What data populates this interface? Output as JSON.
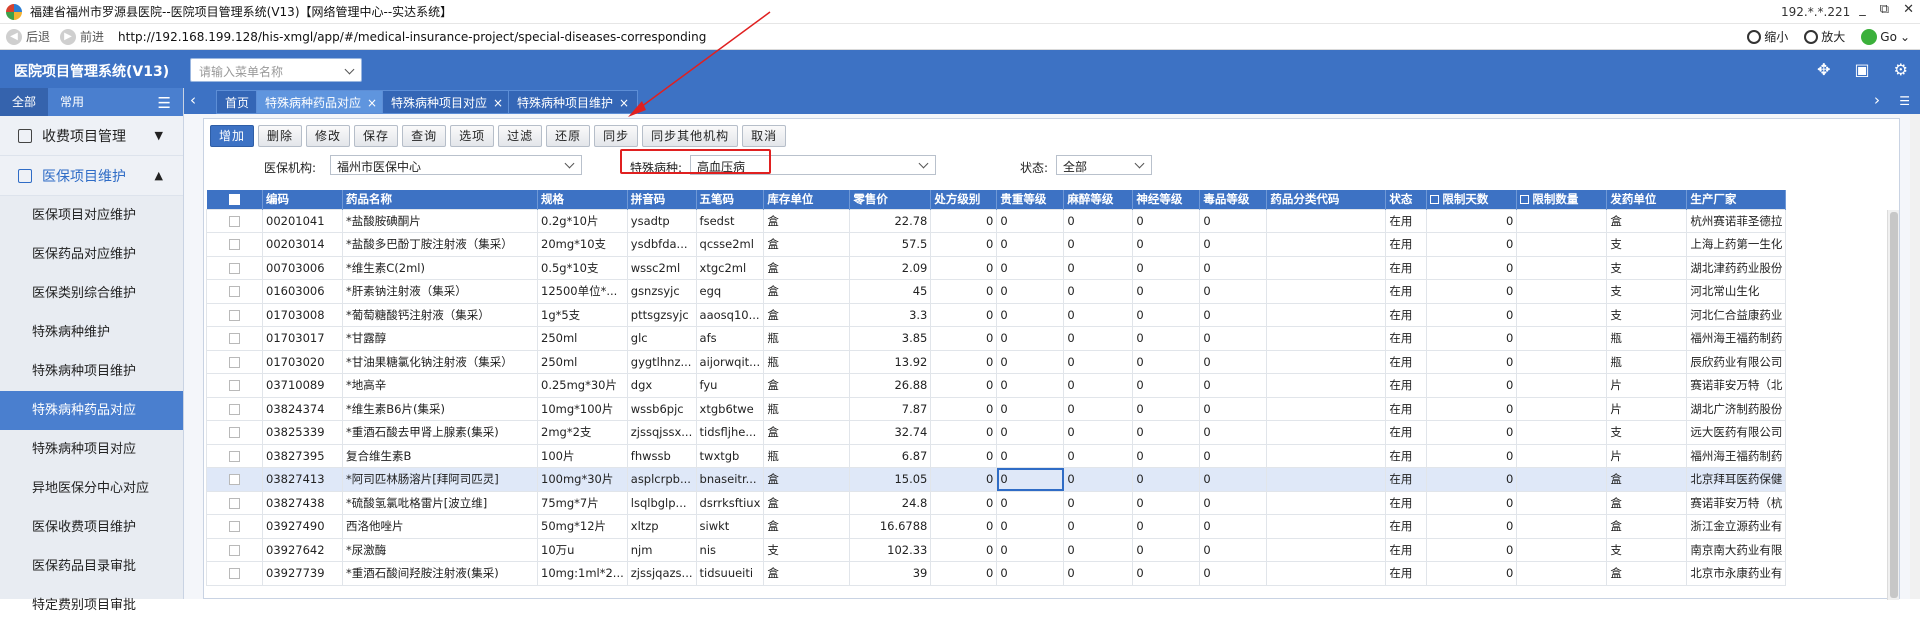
{
  "window": {
    "title": "福建省福州市罗源县医院--医院项目管理系统(V13)【网络管理中心--实达系统】",
    "ip": "192.*.*.221",
    "controls": [
      "_",
      "⧉",
      "✕"
    ]
  },
  "address": {
    "back": "后退",
    "forward": "前进",
    "url": "http://192.168.199.128/his-xmgl/app/#/medical-insurance-project/special-diseases-corresponding",
    "zoom_out": "缩小",
    "zoom_in": "放大",
    "go": "Go"
  },
  "app": {
    "brand": "医院项目管理系统(V13)",
    "menu_search_placeholder": "请输入菜单名称"
  },
  "sidebar": {
    "tabs": [
      "全部",
      "常用"
    ],
    "groups": [
      {
        "label": "收费项目管理",
        "icon": "menu-box-icon",
        "caret": "⌄"
      },
      {
        "label": "医保项目维护",
        "icon": "menu-box-icon",
        "caret": "⌃"
      }
    ],
    "items": [
      "医保项目对应维护",
      "医保药品对应维护",
      "医保类别综合维护",
      "特殊病种维护",
      "特殊病种项目维护",
      "特殊病种药品对应",
      "特殊病种项目对应",
      "异地医保分中心对应",
      "医保收费项目维护",
      "医保药品目录审批",
      "特定费别项目审批"
    ]
  },
  "page_tabs": [
    {
      "label": "首页"
    },
    {
      "label": "特殊病种药品对应",
      "close": "×"
    },
    {
      "label": "特殊病种项目对应",
      "close": "×"
    },
    {
      "label": "特殊病种项目维护",
      "close": "×"
    }
  ],
  "toolbar": [
    "增加",
    "删除",
    "修改",
    "保存",
    "查询",
    "选项",
    "过滤",
    "还原",
    "同步",
    "同步其他机构",
    "取消"
  ],
  "filters": {
    "org_label": "医保机构:",
    "org_value": "福州市医保中心",
    "disease_label": "特殊病种:",
    "disease_value": "高血压病",
    "status_label": "状态:",
    "status_value": "全部"
  },
  "table": {
    "columns": [
      "编码",
      "药品名称",
      "规格",
      "拼音码",
      "五笔码",
      "库存单位",
      "零售价",
      "处方级别",
      "贵重等级",
      "麻醉等级",
      "神经等级",
      "毒品等级",
      "药品分类代码",
      "状态",
      "限制天数",
      "限制数量",
      "发药单位",
      "生产厂家"
    ],
    "rows": [
      [
        "00201041",
        "*盐酸胺碘酮片",
        "0.2g*10片",
        "ysadtp",
        "fsedst",
        "盒",
        "22.78",
        "0",
        "0",
        "0",
        "0",
        "0",
        "",
        "在用",
        "0",
        "",
        "盒",
        "杭州赛诺菲圣德拉"
      ],
      [
        "00203014",
        "*盐酸多巴酚丁胺注射液（集采）",
        "20mg*10支",
        "ysdbfda...",
        "qcsse2ml",
        "盒",
        "57.5",
        "0",
        "0",
        "0",
        "0",
        "0",
        "",
        "在用",
        "0",
        "",
        "支",
        "上海上药第一生化"
      ],
      [
        "00703006",
        "*维生素C(2ml)",
        "0.5g*10支",
        "wssc2ml",
        "xtgc2ml",
        "盒",
        "2.09",
        "0",
        "0",
        "0",
        "0",
        "0",
        "",
        "在用",
        "0",
        "",
        "支",
        "湖北津药药业股份"
      ],
      [
        "01603006",
        "*肝素钠注射液（集采）",
        "12500单位*...",
        "gsnzsyjc",
        "egq",
        "盒",
        "45",
        "0",
        "0",
        "0",
        "0",
        "0",
        "",
        "在用",
        "0",
        "",
        "支",
        "河北常山生化"
      ],
      [
        "01703008",
        "*葡萄糖酸钙注射液（集采）",
        "1g*5支",
        "pttsgzsyjc",
        "aaosq10...",
        "盒",
        "3.3",
        "0",
        "0",
        "0",
        "0",
        "0",
        "",
        "在用",
        "0",
        "",
        "支",
        "河北仁合益康药业"
      ],
      [
        "01703017",
        "*甘露醇",
        "250ml",
        "glc",
        "afs",
        "瓶",
        "3.85",
        "0",
        "0",
        "0",
        "0",
        "0",
        "",
        "在用",
        "0",
        "",
        "瓶",
        "福州海王福药制药"
      ],
      [
        "01703020",
        "*甘油果糖氯化钠注射液（集采）",
        "250ml",
        "gygtlhnz...",
        "aijorwqit...",
        "瓶",
        "13.92",
        "0",
        "0",
        "0",
        "0",
        "0",
        "",
        "在用",
        "0",
        "",
        "瓶",
        "辰欣药业有限公司"
      ],
      [
        "03710089",
        "*地高辛",
        "0.25mg*30片",
        "dgx",
        "fyu",
        "盒",
        "26.88",
        "0",
        "0",
        "0",
        "0",
        "0",
        "",
        "在用",
        "0",
        "",
        "片",
        "赛诺菲安万特（北"
      ],
      [
        "03824374",
        "*维生素B6片(集采)",
        "10mg*100片",
        "wssb6pjc",
        "xtgb6twe",
        "瓶",
        "7.87",
        "0",
        "0",
        "0",
        "0",
        "0",
        "",
        "在用",
        "0",
        "",
        "片",
        "湖北广济制药股份"
      ],
      [
        "03825339",
        "*重酒石酸去甲肾上腺素(集采)",
        "2mg*2支",
        "zjssqjssx...",
        "tidsfljhe...",
        "盒",
        "32.74",
        "0",
        "0",
        "0",
        "0",
        "0",
        "",
        "在用",
        "0",
        "",
        "支",
        "远大医药有限公司"
      ],
      [
        "03827395",
        "复合维生素B",
        "100片",
        "fhwssb",
        "twxtgb",
        "瓶",
        "6.87",
        "0",
        "0",
        "0",
        "0",
        "0",
        "",
        "在用",
        "0",
        "",
        "片",
        "福州海王福药制药"
      ],
      [
        "03827413",
        "*阿司匹林肠溶片[拜阿司匹灵]",
        "100mg*30片",
        "asplcrpb...",
        "bnaseitr...",
        "盒",
        "15.05",
        "0",
        "0",
        "0",
        "0",
        "0",
        "",
        "在用",
        "0",
        "",
        "盒",
        "北京拜耳医药保健"
      ],
      [
        "03827438",
        "*硫酸氢氯吡格雷片[波立维]",
        "75mg*7片",
        "lsqlbglp...",
        "dsrrksftiux",
        "盒",
        "24.8",
        "0",
        "0",
        "0",
        "0",
        "0",
        "",
        "在用",
        "0",
        "",
        "盒",
        "赛诺菲安万特（杭"
      ],
      [
        "03927490",
        "西洛他唑片",
        "50mg*12片",
        "xltzp",
        "siwkt",
        "盒",
        "16.6788",
        "0",
        "0",
        "0",
        "0",
        "0",
        "",
        "在用",
        "0",
        "",
        "盒",
        "浙江金立源药业有"
      ],
      [
        "03927642",
        "*尿激酶",
        "10万u",
        "njm",
        "nis",
        "支",
        "102.33",
        "0",
        "0",
        "0",
        "0",
        "0",
        "",
        "在用",
        "0",
        "",
        "支",
        "南京南大药业有限"
      ],
      [
        "03927739",
        "*重酒石酸间羟胺注射液(集采)",
        "10mg:1ml*2...",
        "zjssjqazs...",
        "tidsuueiti",
        "盒",
        "39",
        "0",
        "0",
        "0",
        "0",
        "0",
        "",
        "在用",
        "0",
        "",
        "盒",
        "北京市永康药业有"
      ]
    ],
    "highlight_row": 11
  }
}
